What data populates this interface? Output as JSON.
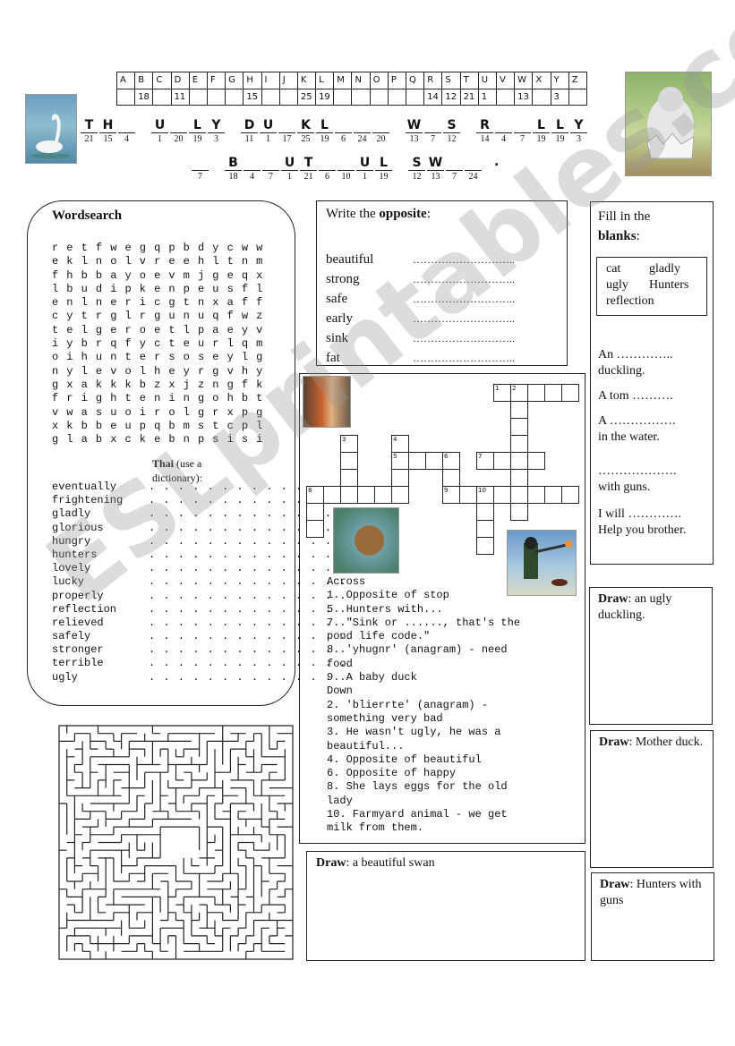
{
  "cipher": {
    "letters": [
      "A",
      "B",
      "C",
      "D",
      "E",
      "F",
      "G",
      "H",
      "I",
      "J",
      "K",
      "L",
      "M",
      "N",
      "O",
      "P",
      "Q",
      "R",
      "S",
      "T",
      "U",
      "V",
      "W",
      "X",
      "Y",
      "Z"
    ],
    "codes": [
      "",
      "18",
      "",
      "11",
      "",
      "",
      "",
      "15",
      "",
      "",
      "25",
      "19",
      "",
      "",
      "",
      "",
      "",
      "14",
      "12",
      "21",
      "1",
      "",
      "13",
      "",
      "3",
      ""
    ]
  },
  "puzzle": {
    "line1": [
      [
        [
          "T",
          "21"
        ],
        [
          "H",
          "15"
        ],
        [
          "",
          "4"
        ]
      ],
      [
        [
          "U",
          "1"
        ],
        [
          "",
          "20"
        ],
        [
          "L",
          "19"
        ],
        [
          "Y",
          "3"
        ]
      ],
      [
        [
          "D",
          "11"
        ],
        [
          "U",
          "1"
        ],
        [
          "",
          "17"
        ],
        [
          "K",
          "25"
        ],
        [
          "L",
          "19"
        ],
        [
          "",
          "6"
        ],
        [
          "",
          "24"
        ],
        [
          "",
          "20"
        ]
      ],
      [
        [
          "W",
          "13"
        ],
        [
          "",
          "7"
        ],
        [
          "S",
          "12"
        ]
      ],
      [
        [
          "R",
          "14"
        ],
        [
          "",
          "4"
        ],
        [
          "",
          "7"
        ],
        [
          "L",
          "19"
        ],
        [
          "L",
          "19"
        ],
        [
          "Y",
          "3"
        ]
      ]
    ],
    "line2": [
      [
        [
          "",
          "7"
        ]
      ],
      [
        [
          "B",
          "18"
        ],
        [
          "",
          "4"
        ],
        [
          "",
          "7"
        ],
        [
          "U",
          "1"
        ],
        [
          "T",
          "21"
        ],
        [
          "",
          "6"
        ],
        [
          "",
          "10"
        ],
        [
          "U",
          "1"
        ],
        [
          "L",
          "19"
        ]
      ],
      [
        [
          "S",
          "12"
        ],
        [
          "W",
          "13"
        ],
        [
          "",
          "7"
        ],
        [
          "",
          "24"
        ]
      ]
    ],
    "end_mark": "."
  },
  "wordsearch": {
    "title": "Wordsearch",
    "grid": [
      "retfwegqpbdycww",
      "eklnolvreehltnm",
      "fhbbayoevmjgeqx",
      "lbudipkenpeusfl",
      "enlnericgtnxaff",
      "cytrglrgunuqfwz",
      "telgeroetlpaeyv",
      "iybrqfycteurlqm",
      "oihuntersoseylg",
      "nylevolheyrgvhy",
      "gxakkkbzxjzngfk",
      "frighteningohbt",
      "vwasuoirolgrxpg",
      "xkbbeupqbmstcpl",
      "glabxckebnpsisi"
    ],
    "thai_label_bold": "Thai",
    "thai_label_rest": " (use a dictionary):",
    "words": [
      "eventually",
      "frightening",
      "gladly",
      "glorious",
      "hungry",
      "hunters",
      "lovely",
      "lucky",
      "properly",
      "reflection",
      "relieved",
      "safely",
      "stronger",
      "terrible",
      "ugly"
    ],
    "dots": ". . . . . . . . . . . . . ."
  },
  "opposite": {
    "title_plain": "Write the ",
    "title_bold": "opposite",
    "title_end": ":",
    "words": [
      "beautiful",
      "strong",
      "safe",
      "early",
      "sink",
      "fat"
    ],
    "dots": "……………………….."
  },
  "crossword": {
    "entries": [
      {
        "num": "1",
        "row": 0,
        "col": 11,
        "dir": "across",
        "len": 5
      },
      {
        "num": "2",
        "row": 0,
        "col": 12,
        "dir": "down",
        "len": 8
      },
      {
        "num": "3",
        "row": 3,
        "col": 2,
        "dir": "down",
        "len": 4
      },
      {
        "num": "4",
        "row": 3,
        "col": 5,
        "dir": "down",
        "len": 4
      },
      {
        "num": "5",
        "row": 4,
        "col": 5,
        "dir": "across",
        "len": 4
      },
      {
        "num": "6",
        "row": 4,
        "col": 8,
        "dir": "down",
        "len": 3
      },
      {
        "num": "7",
        "row": 4,
        "col": 10,
        "dir": "across",
        "len": 4
      },
      {
        "num": "8",
        "row": 6,
        "col": 0,
        "dir": "across",
        "len": 6
      },
      {
        "num": "8",
        "row": 6,
        "col": 0,
        "dir": "down",
        "len": 3
      },
      {
        "num": "9",
        "row": 6,
        "col": 8,
        "dir": "across",
        "len": 8
      },
      {
        "num": "10",
        "row": 6,
        "col": 10,
        "dir": "down",
        "len": 4
      }
    ],
    "clue_lines": [
      "Across",
      "1. Opposite of stop",
      "5. Hunters with...",
      "7. \"Sink or ......, that's the",
      "pond life code.\"",
      "8. 'yhugnr' (anagram) - need",
      "food",
      "9. A baby duck",
      "Down",
      "2. 'blierrte' (anagram) -",
      "something very bad",
      "3. He wasn't ugly, he was a",
      "beautiful...",
      "4. Opposite of beautiful",
      "6. Opposite of happy",
      "8. She lays eggs for the old",
      "lady",
      "10. Farmyard animal - we get",
      "milk from them."
    ]
  },
  "fill": {
    "title_plain": "Fill in the",
    "title_bold": "blanks",
    "title_end": ":",
    "bank": [
      "cat",
      "gladly",
      "ugly",
      "Hunters",
      "reflection"
    ],
    "sentences": [
      [
        "An …………..",
        "duckling."
      ],
      [
        "A tom ……….",
        ""
      ],
      [
        "A …………….",
        "in the water."
      ],
      [
        "……………….",
        "with guns."
      ],
      [
        "I will ………….",
        "Help you brother."
      ]
    ]
  },
  "draw": [
    {
      "bold": "Draw",
      "rest": ": an ugly duckling."
    },
    {
      "bold": "Draw",
      "rest": ": Mother duck."
    },
    {
      "bold": "Draw",
      "rest": ": Hunters with guns"
    },
    {
      "bold": "Draw",
      "rest": ": a beautiful swan"
    }
  ],
  "watermark": "ESLprintables.com",
  "colors": {
    "ink": "#111111",
    "watermark": "#969696"
  }
}
